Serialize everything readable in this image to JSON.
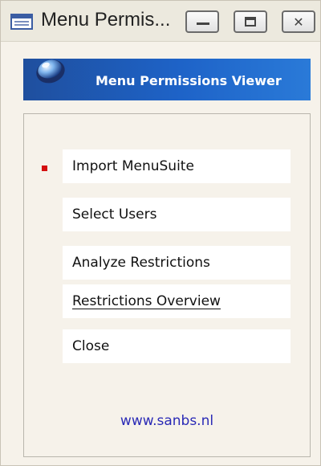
{
  "window": {
    "title": "Menu Permis...",
    "icon": "table-window-icon",
    "controls": {
      "minimize_icon": "minimize-icon",
      "maximize_icon": "maximize-icon",
      "close_icon": "close-icon",
      "close_glyph": "✕"
    }
  },
  "header": {
    "title": "Menu Permissions Viewer",
    "logo_icon": "globe-icon",
    "colors": {
      "banner": "#1e63c8"
    }
  },
  "menu": {
    "items": [
      {
        "label": "Import MenuSuite",
        "active": true
      },
      {
        "label": "Select Users"
      },
      {
        "label": "Analyze Restrictions"
      },
      {
        "label": "Restrictions Overview",
        "focused": true
      },
      {
        "label": "Close"
      }
    ],
    "bullet_color": "#d40f0f"
  },
  "footer": {
    "link": "www.sanbs.nl",
    "link_color": "#2a2ab6"
  }
}
